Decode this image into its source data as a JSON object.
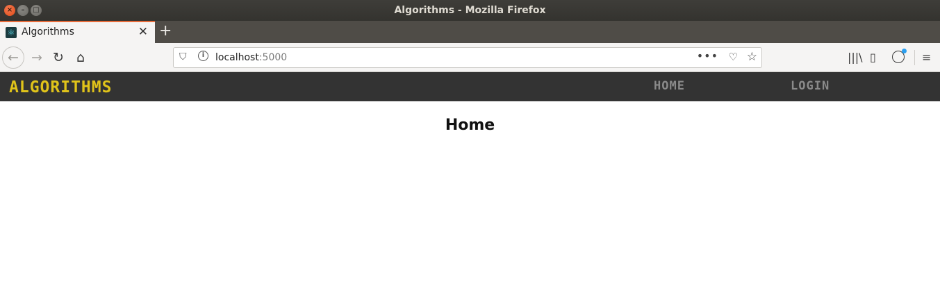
{
  "window": {
    "title": "Algorithms - Mozilla Firefox",
    "close_glyph": "×",
    "min_glyph": "–",
    "max_glyph": "□"
  },
  "tabs": [
    {
      "label": "Algorithms",
      "favicon": "react-icon",
      "close_glyph": "✕"
    }
  ],
  "new_tab_glyph": "+",
  "toolbar": {
    "back_glyph": "←",
    "forward_glyph": "→",
    "reload_glyph": "↻",
    "home_glyph": "⌂",
    "library_glyph": "|||\\",
    "sidebar_glyph": "▯",
    "menu_glyph": "≡"
  },
  "urlbar": {
    "host": "localhost",
    "port": ":5000",
    "shield_glyph": "⛉",
    "info_glyph": "i",
    "page_actions_glyph": "•••",
    "pocket_glyph": "♡",
    "bookmark_glyph": "☆"
  },
  "site": {
    "brand": "ALGORITHMS",
    "nav": [
      {
        "label": "HOME"
      },
      {
        "label": "LOGIN"
      }
    ],
    "heading": "Home"
  },
  "colors": {
    "brand": "#e0c31a",
    "navbar_bg": "#333333",
    "nav_link": "#8a8a8a",
    "tab_accent": "#e66b3a"
  }
}
